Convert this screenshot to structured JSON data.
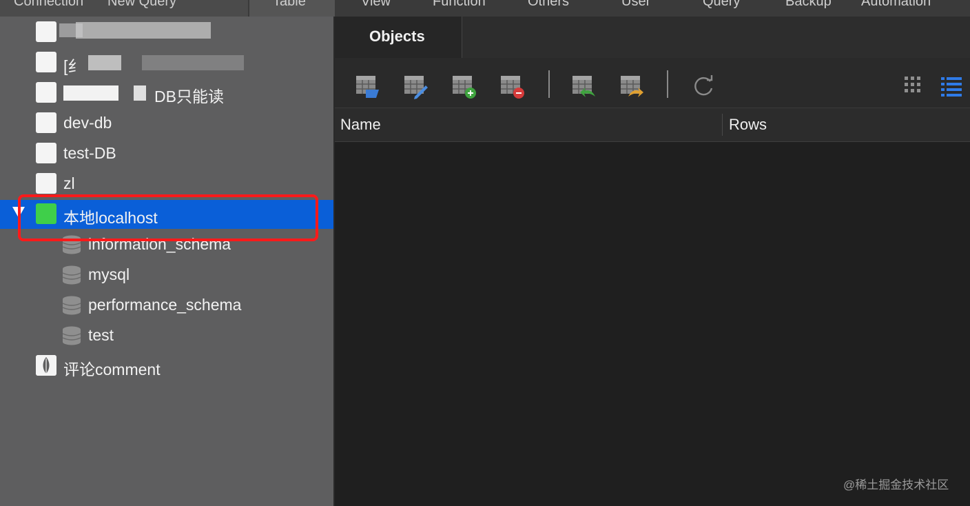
{
  "toolbar": {
    "items": [
      "Connection",
      "New Query",
      "Table",
      "View",
      "Function",
      "Others",
      "User",
      "Query",
      "Backup",
      "Automation"
    ]
  },
  "sidebar": {
    "connections": [
      {
        "label": "",
        "icon": "mysql-icon"
      },
      {
        "label": "[纟",
        "icon": "mysql-icon"
      },
      {
        "label": "DB只能读",
        "icon": "mysql-icon"
      },
      {
        "label": "dev-db",
        "icon": "mysql-icon"
      },
      {
        "label": "test-DB",
        "icon": "mysql-icon"
      },
      {
        "label": "zl",
        "icon": "mysql-icon"
      },
      {
        "label": "本地localhost",
        "icon": "mysql-icon",
        "selected": true,
        "expanded": true
      },
      {
        "label": "评论comment",
        "icon": "mongodb-leaf-icon"
      }
    ],
    "databases": [
      "information_schema",
      "mysql",
      "performance_schema",
      "test"
    ]
  },
  "tabs": {
    "objects": "Objects"
  },
  "table": {
    "columns": [
      "Name",
      "Rows"
    ]
  },
  "watermark": "@稀土掘金技术社区",
  "colors": {
    "selection": "#0a5fd8",
    "highlight": "#ff1a1a",
    "sidebar": "#5e5e5f"
  }
}
